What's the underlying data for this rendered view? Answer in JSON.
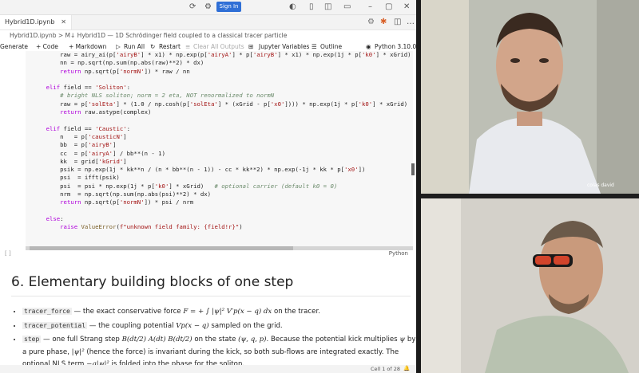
{
  "browser": {
    "sign_in": "Sign In"
  },
  "editor": {
    "tab_label": "Hybrid1D.ipynb",
    "breadcrumb": "Hybrid1D.ipynb > M↓ Hybrid1D — 1D Schrödinger field coupled to a classical tracer particle",
    "toolbar": {
      "generate": "Generate",
      "code": "+ Code",
      "markdown": "+ Markdown",
      "run_all": "Run All",
      "restart": "Restart",
      "clear_all_outputs": "Clear All Outputs",
      "jupyter_variables": "Jupyter Variables",
      "outline": "Outline",
      "kernel": "Python 3.10.0"
    },
    "code_lines": [
      "        raw = airy_ai(p['airyB'] * x1) * np.exp(p['airyA'] * p['airyB'] * x1) * np.exp(1j * p['k0'] * xGrid)",
      "        nn = np.sqrt(np.sum(np.abs(raw)**2) * dx)",
      "        return np.sqrt(p['normN']) * raw / nn",
      "",
      "    elif field == 'Soliton':",
      "        # bright NLS soliton; norm = 2 eta, NOT renormalized to normN",
      "        raw = p['solEta'] * (1.0 / np.cosh(p['solEta'] * (xGrid - p['x0']))) * np.exp(1j * p['k0'] * xGrid)",
      "        return raw.astype(complex)",
      "",
      "    elif field == 'Caustic':",
      "        n   = p['causticN']",
      "        bb  = p['airyB']",
      "        cc  = p['airyA'] / bb**(n - 1)",
      "        kk  = grid['kGrid']",
      "        psik = np.exp(1j * kk**n / (n * bb**(n - 1)) - cc * kk**2) * np.exp(-1j * kk * p['x0'])",
      "        psi  = ifft(psik)",
      "        psi  = psi * np.exp(1j * p['k0'] * xGrid)   # optional carrier (default k0 = 0)",
      "        nrm  = np.sqrt(np.sum(np.abs(psi)**2) * dx)",
      "        return np.sqrt(p['normN']) * psi / nrm",
      "",
      "    else:",
      "        raise ValueError(f\"unknown field family: {field!r}\")"
    ],
    "cell_language": "Python",
    "bracket": "[ ]",
    "section_heading": "6. Elementary building blocks of one step",
    "bullets": [
      {
        "name": "tracer_force",
        "pre": " — the exact conservative force ",
        "math": "F = + ∫ |ψ|² V′p(x − q) dx",
        "post": " on the tracer."
      },
      {
        "name": "tracer_potential",
        "pre": " — the coupling potential ",
        "math": "Vp(x − q)",
        "post": " sampled on the grid."
      },
      {
        "name": "step",
        "pre": " — one full Strang step ",
        "math": "B(dt/2) A(dt) B(dt/2)",
        "mid1": " on the state ",
        "math2": "(ψ, q, p)",
        "mid2": ". Because the potential kick multiplies ",
        "math3": "ψ",
        "mid3": " by a pure phase, ",
        "math4": "|ψ|²",
        "mid4": " (hence the force) is invariant during the kick, so both sub-flows are integrated exactly. The optional NLS term ",
        "math5": "−g|ψ|²",
        "post": " is folded into the phase for the soliton."
      }
    ],
    "status": {
      "cell": "Cell 1 of 28"
    }
  },
  "video": {
    "participant_label": "colas david"
  }
}
